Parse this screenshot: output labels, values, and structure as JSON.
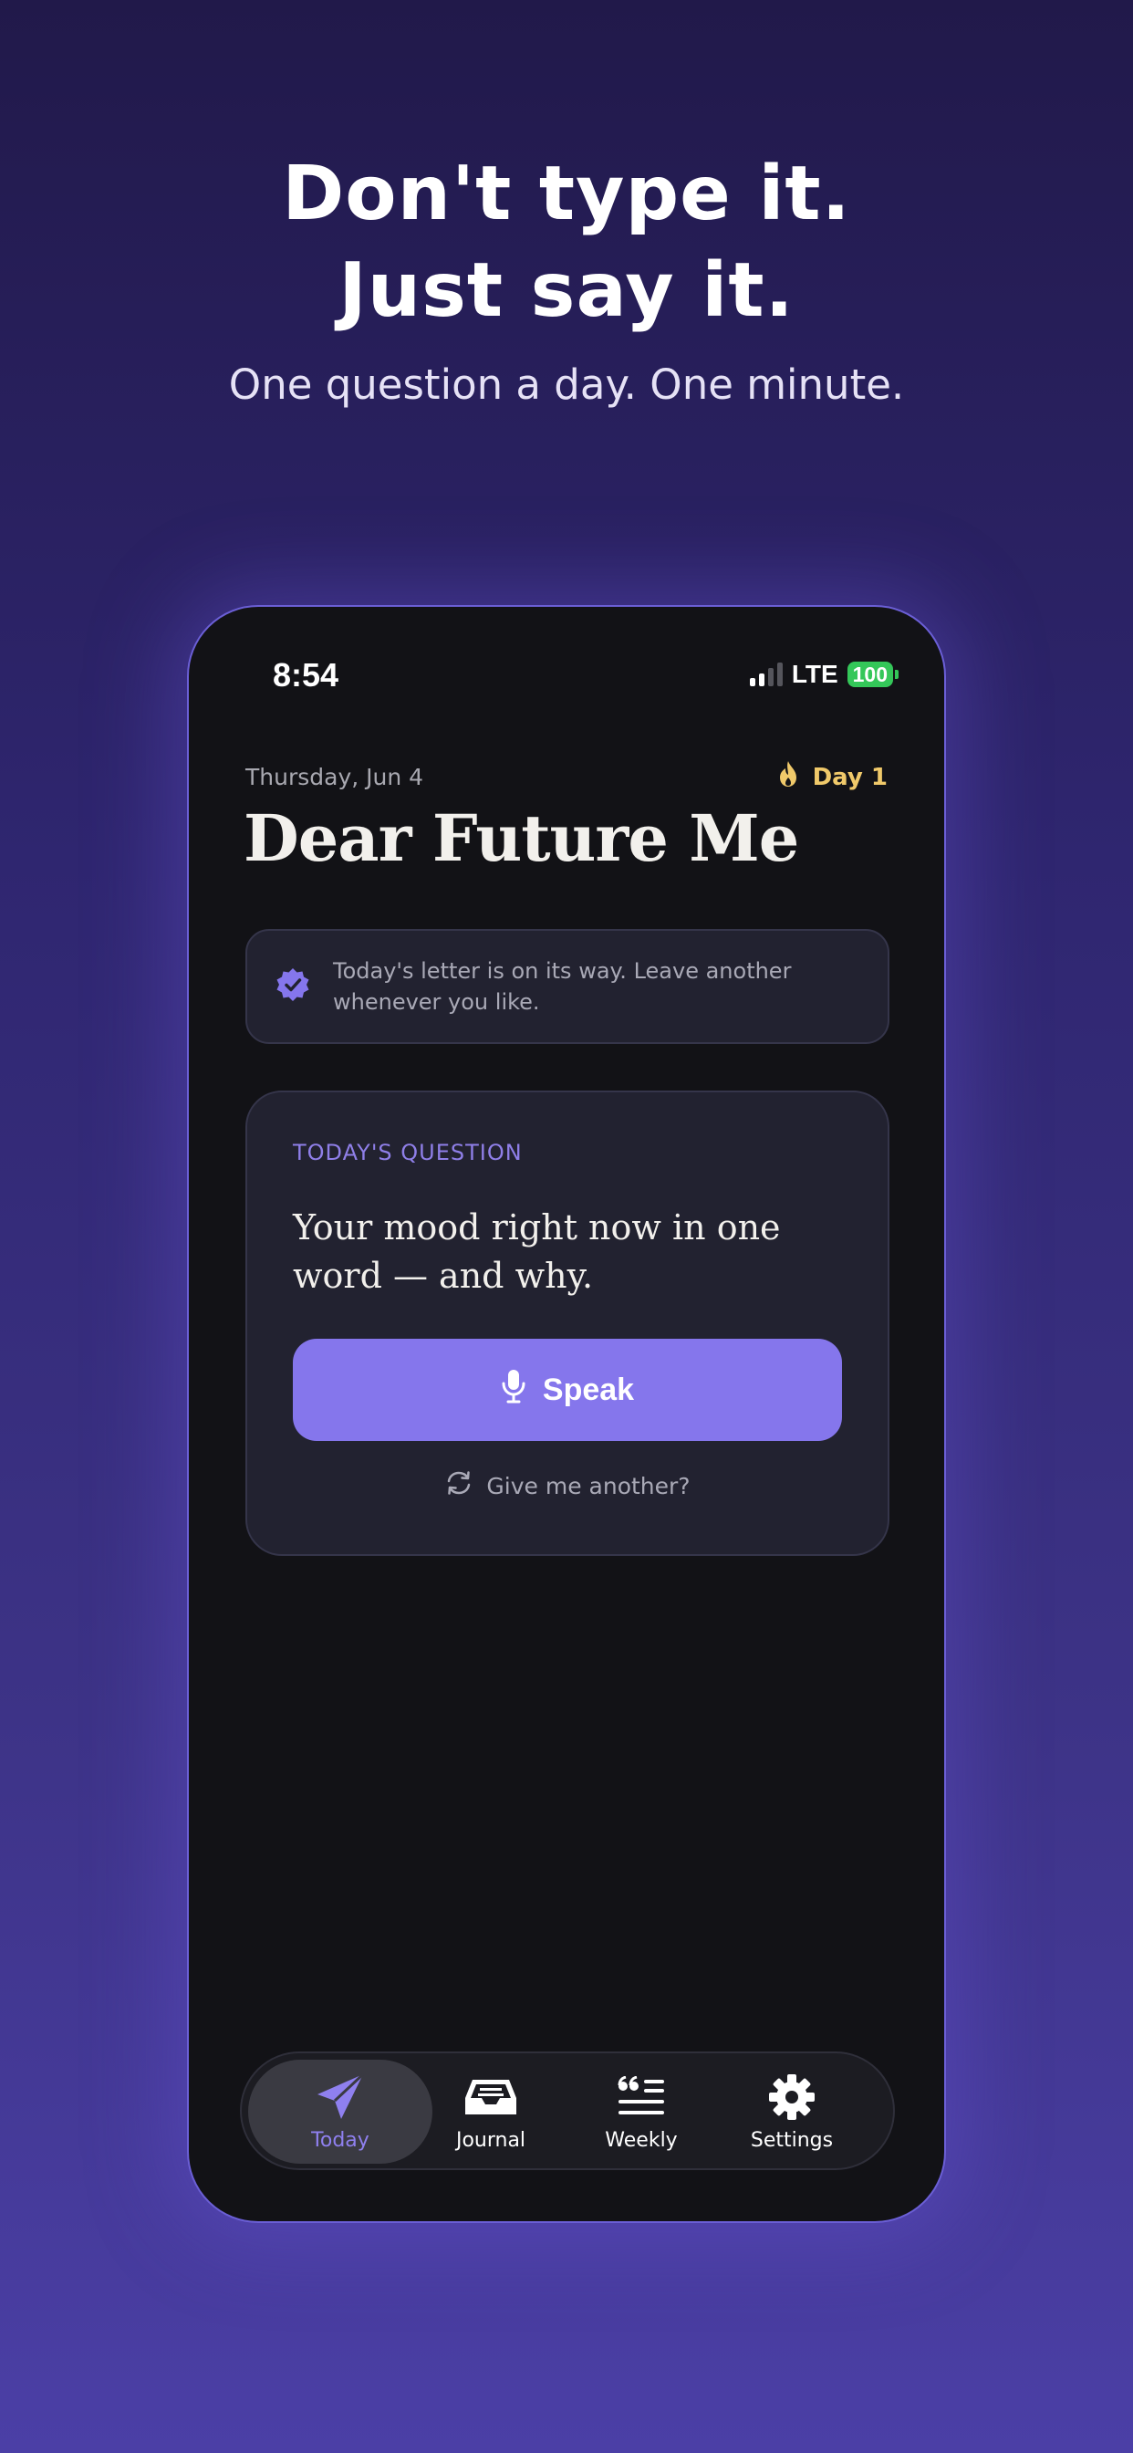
{
  "marketing": {
    "headline_line1": "Don't type it.",
    "headline_line2": "Just say it.",
    "subhead": "One question a day. One minute."
  },
  "status_bar": {
    "time": "8:54",
    "network": "LTE",
    "battery": "100"
  },
  "header": {
    "date": "Thursday, Jun 4",
    "streak_icon": "flame-icon",
    "streak": "Day 1",
    "title": "Dear Future Me"
  },
  "notice": {
    "icon": "verified-badge-icon",
    "text": "Today's letter is on its way. Leave another whenever you like."
  },
  "question_card": {
    "label": "TODAY'S QUESTION",
    "question": "Your mood right now in one word — and why.",
    "speak_icon": "microphone-icon",
    "speak_label": "Speak",
    "another_icon": "refresh-icon",
    "another_label": "Give me another?"
  },
  "tabs": [
    {
      "label": "Today",
      "icon": "paper-plane-icon",
      "active": true
    },
    {
      "label": "Journal",
      "icon": "inbox-tray-icon",
      "active": false
    },
    {
      "label": "Weekly",
      "icon": "quote-list-icon",
      "active": false
    },
    {
      "label": "Settings",
      "icon": "gear-icon",
      "active": false
    }
  ],
  "colors": {
    "accent": "#8576ec",
    "streak": "#f0c96a",
    "battery": "#34c759",
    "screen_bg": "#121216",
    "card_bg": "#222230"
  }
}
